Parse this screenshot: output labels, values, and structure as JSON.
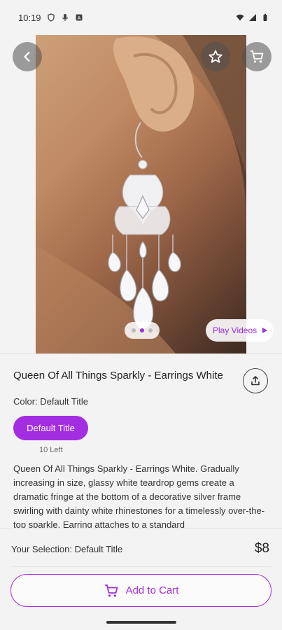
{
  "status_bar": {
    "time": "10:19"
  },
  "product": {
    "title": "Queen Of All Things Sparkly - Earrings White",
    "color_label": "Color: Default Title",
    "variant_label": "Default Title",
    "stock": "10 Left",
    "description": "Queen Of All Things Sparkly - Earrings White. Gradually increasing in size, glassy white teardrop gems create a dramatic fringe at the bottom of a decorative silver frame swirling with dainty white rhinestones for a timelessly over-the-top sparkle. Earring attaches to a standard"
  },
  "gallery": {
    "play_videos_label": "Play Videos",
    "active_dot": 1
  },
  "footer": {
    "selection": "Your Selection: Default Title",
    "price": "$8",
    "add_to_cart_label": "Add to Cart"
  },
  "colors": {
    "accent": "#a32de0"
  }
}
